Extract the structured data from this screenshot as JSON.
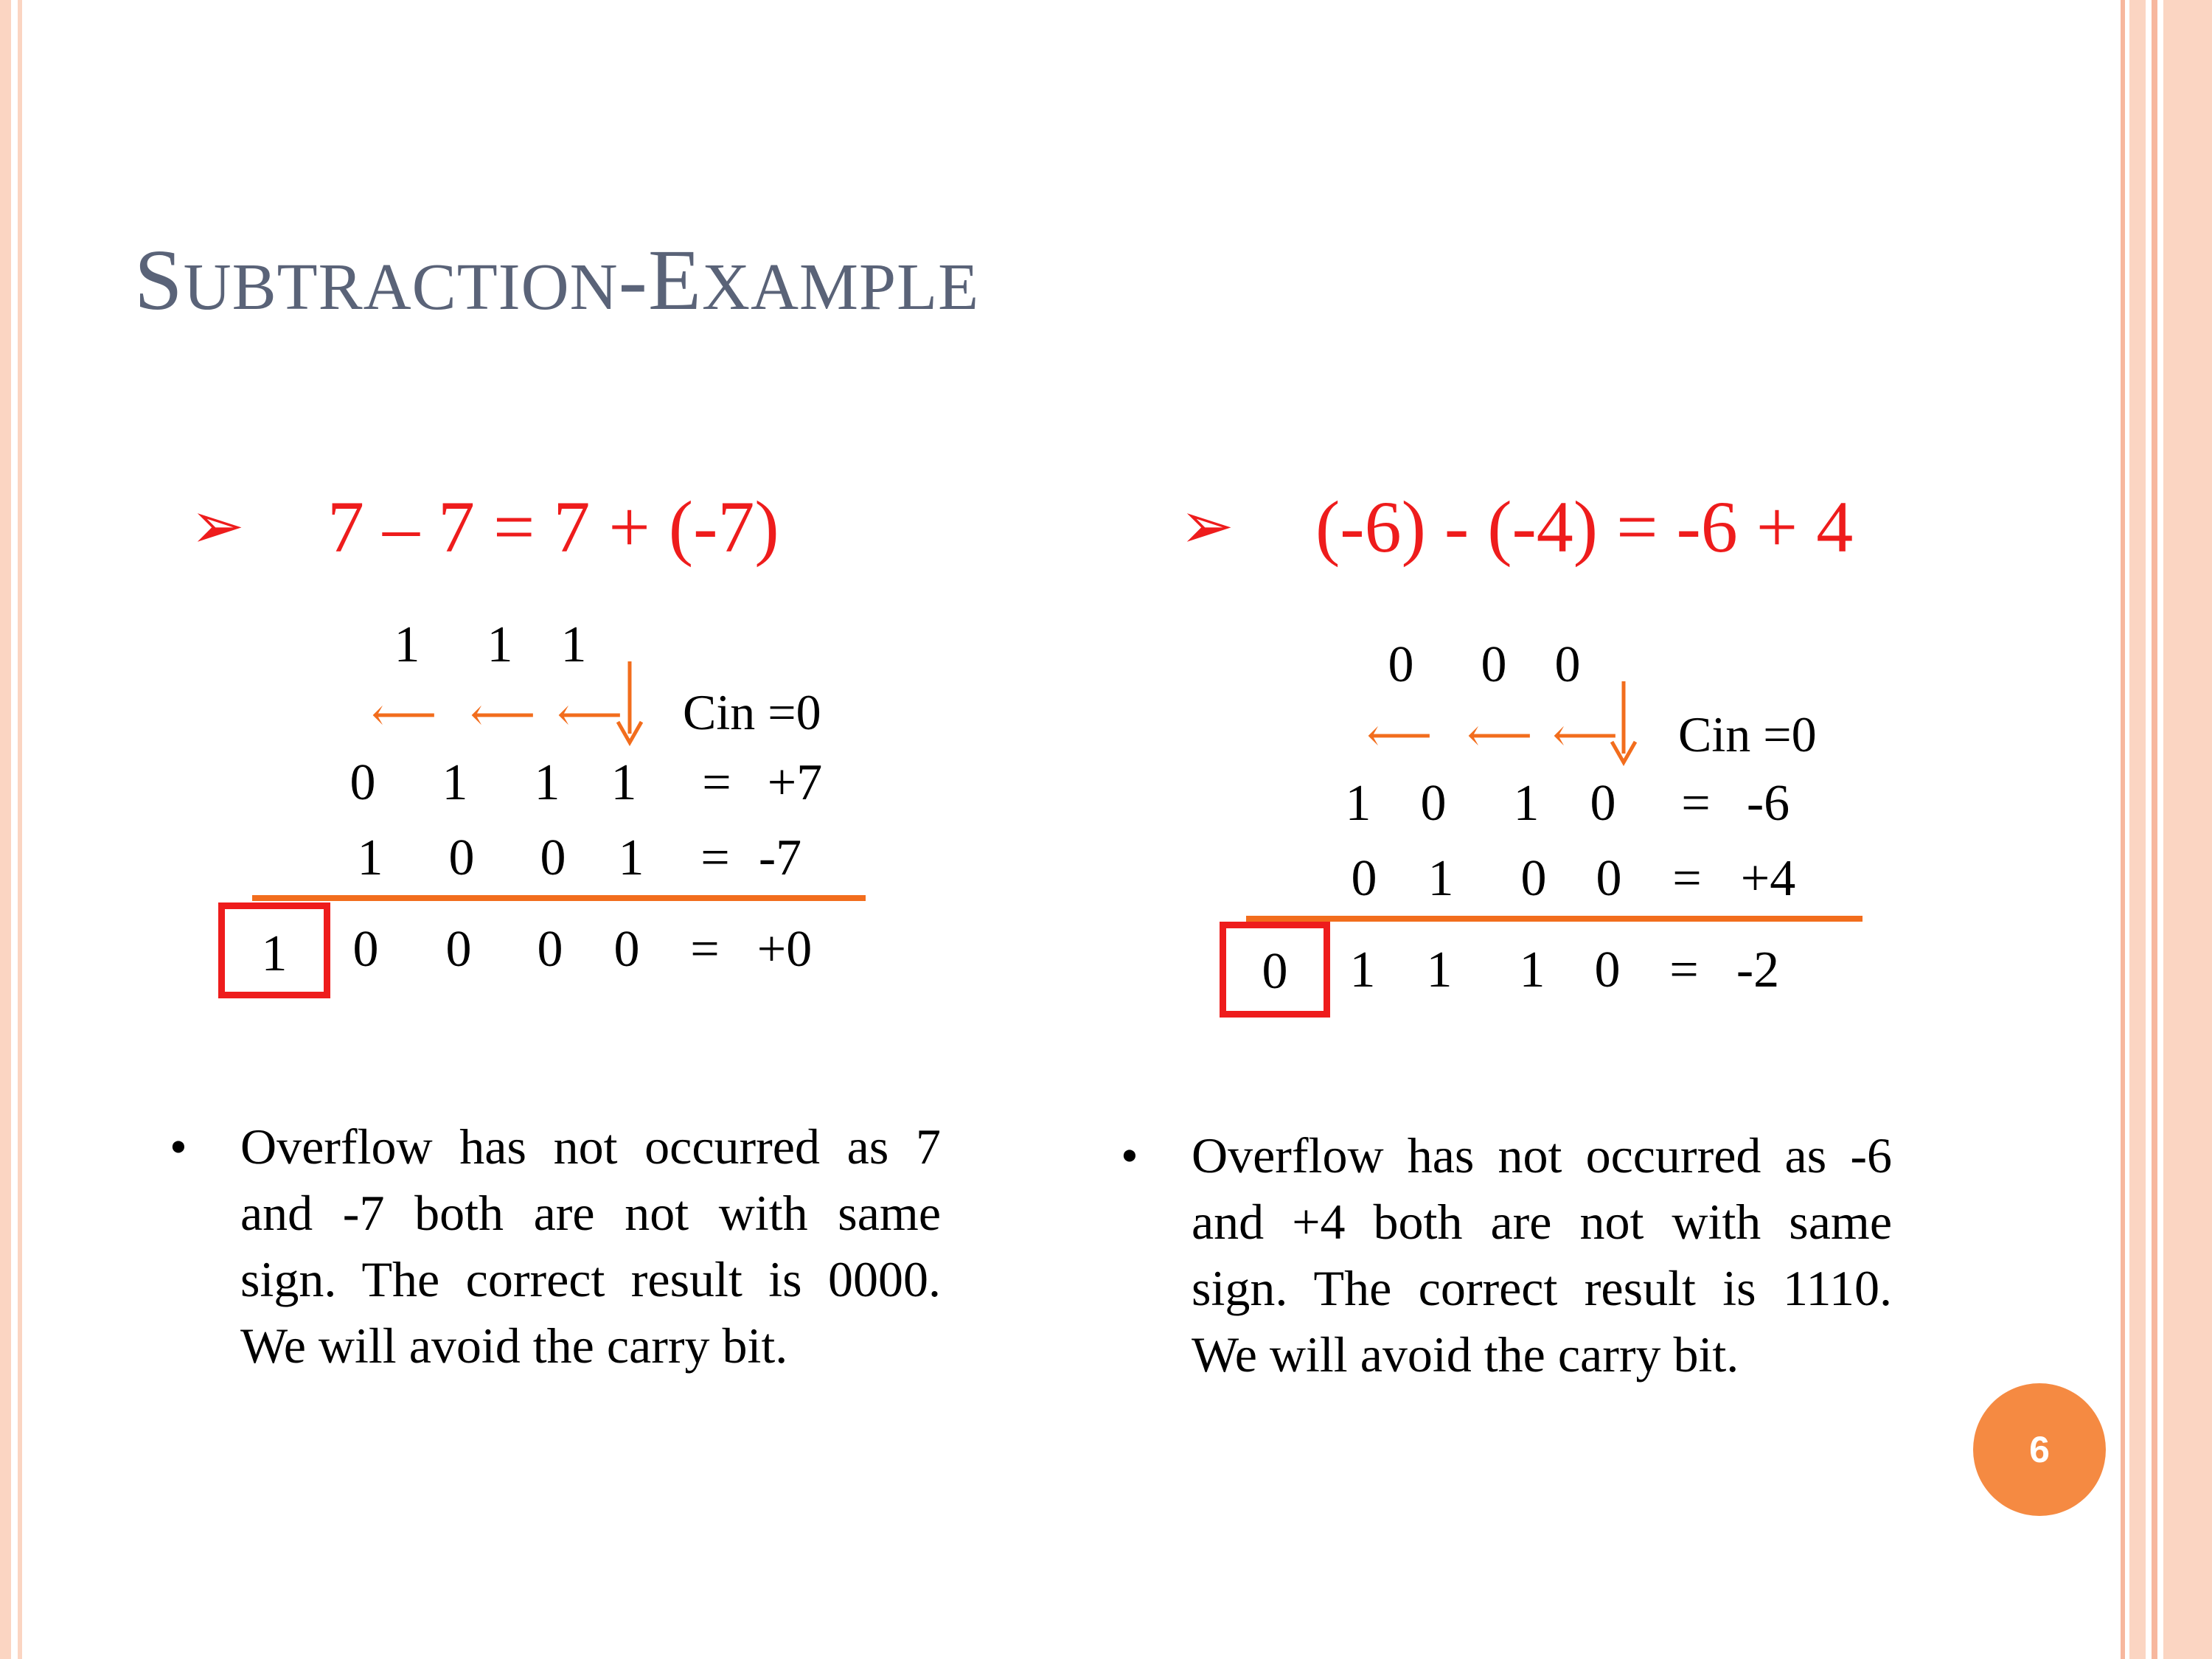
{
  "slide": {
    "title_cap1": "S",
    "title_small1": "UBTRACTION",
    "title_sep": "-",
    "title_cap2": "E",
    "title_small2": "XAMPLE",
    "page_number": "6",
    "arrow_bullet": "➢",
    "text_bullet": "•"
  },
  "left": {
    "heading": "7 – 7 = 7 + (-7)",
    "carries": [
      "1",
      "1",
      "1"
    ],
    "cin": "Cin =0",
    "row1": [
      "0",
      "1",
      "1",
      "1",
      "=",
      "+7"
    ],
    "row2": [
      "1",
      "0",
      "0",
      "1",
      "=",
      "-7"
    ],
    "carry_out": "1",
    "result": [
      "0",
      "0",
      "0",
      "0",
      "=",
      "+0"
    ],
    "note": "Overflow has not occurred as 7 and -7 both are not with same sign. The correct result is 0000. We will avoid the carry bit."
  },
  "right": {
    "heading": "(-6) - (-4) = -6 + 4",
    "carries": [
      "0",
      "0",
      "0"
    ],
    "cin": "Cin =0",
    "row1": [
      "1",
      "0",
      "1",
      "0",
      "=",
      "-6"
    ],
    "row2": [
      "0",
      "1",
      "0",
      "0",
      "=",
      "+4"
    ],
    "carry_out": "0",
    "result": [
      "1",
      "1",
      "1",
      "0",
      "=",
      "-2"
    ],
    "note": "Overflow has not occurred as -6 and +4 both are not with same sign. The correct result is 1110. We will avoid the carry bit."
  },
  "colors": {
    "title": "#5a6378",
    "heading": "#ee1c1c",
    "arrows_and_rule": "#f26d1d",
    "carry_box": "#ee1c1c",
    "page_badge": "#f58a42",
    "border": "#fbd5c2"
  }
}
